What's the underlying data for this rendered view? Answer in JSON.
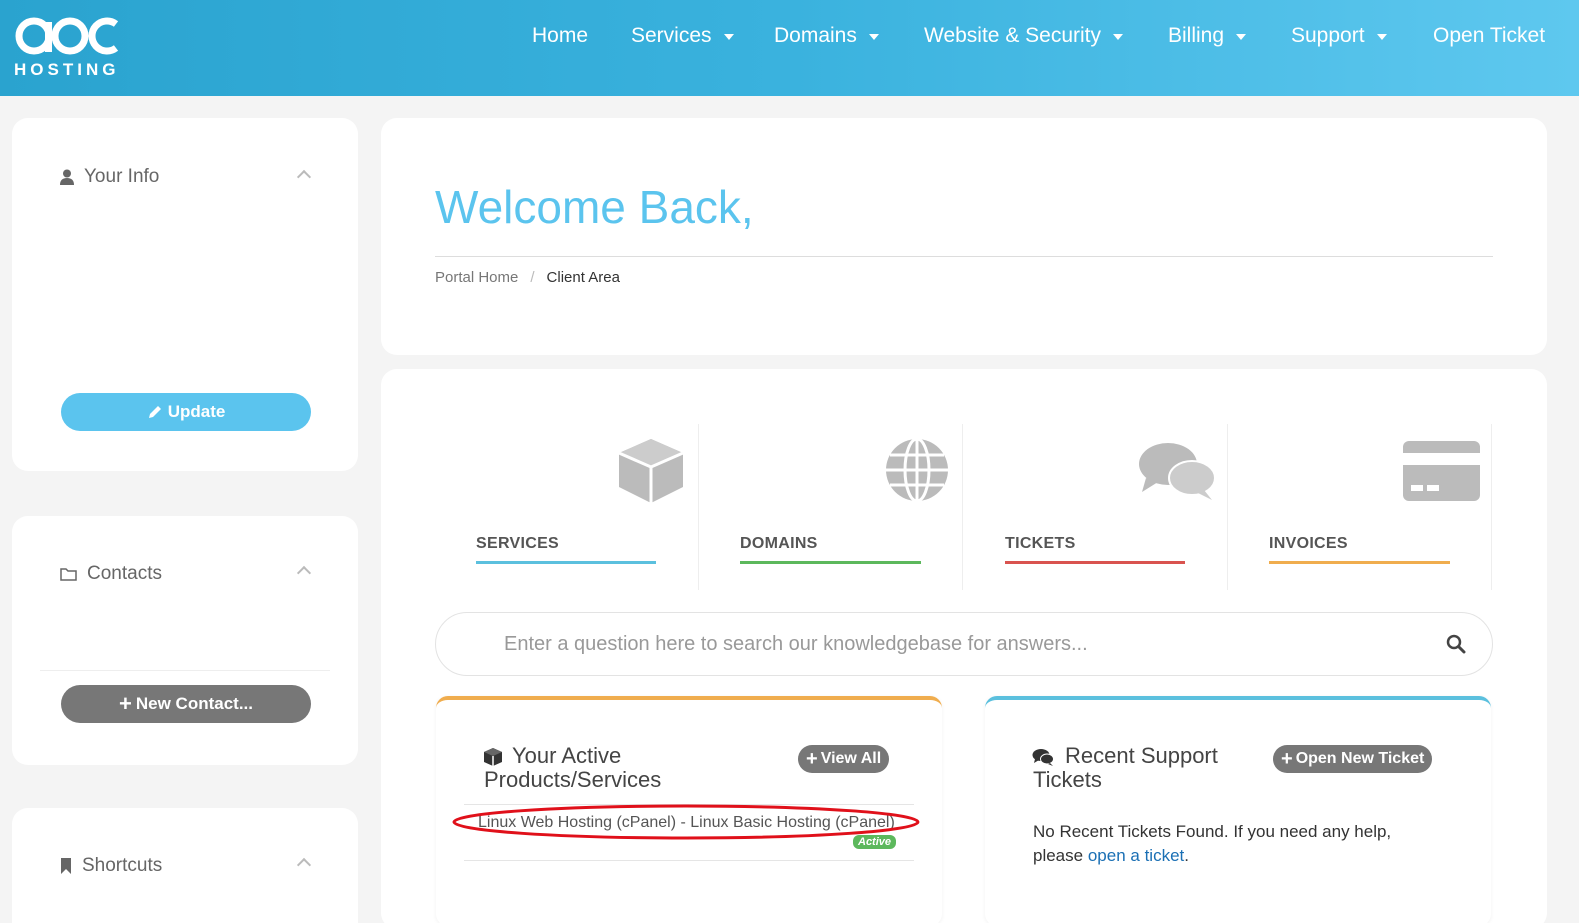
{
  "brand": {
    "logo_letters": "apc",
    "logo_word": "HOSTING"
  },
  "nav": {
    "home": "Home",
    "services": "Services",
    "domains": "Domains",
    "website_security": "Website & Security",
    "billing": "Billing",
    "support": "Support",
    "open_ticket": "Open Ticket"
  },
  "sidebar": {
    "your_info": {
      "title": "Your Info",
      "button": "Update"
    },
    "contacts": {
      "title": "Contacts",
      "button": "New Contact..."
    },
    "shortcuts": {
      "title": "Shortcuts"
    }
  },
  "main": {
    "welcome": "Welcome Back,",
    "breadcrumb": {
      "home": "Portal Home",
      "separator": "/",
      "current": "Client Area"
    }
  },
  "tiles": [
    {
      "label": "SERVICES",
      "color": "#5bc0de"
    },
    {
      "label": "DOMAINS",
      "color": "#5cb85c"
    },
    {
      "label": "TICKETS",
      "color": "#d9534f"
    },
    {
      "label": "INVOICES",
      "color": "#f0ad4e"
    }
  ],
  "search": {
    "placeholder": "Enter a question here to search our knowledgebase for answers..."
  },
  "products_card": {
    "title_line1": "Your Active",
    "title_line2": "Products/Services",
    "view_all": "View All",
    "item": "Linux Web Hosting (cPanel) - Linux Basic Hosting (cPanel)",
    "status": "Active",
    "accent": "#f0ad4e"
  },
  "tickets_card": {
    "title_line1": "Recent Support",
    "title_line2": "Tickets",
    "button": "Open New Ticket",
    "text": "No Recent Tickets Found. If you need any help,",
    "text2": "please",
    "link": "open a ticket",
    "text_end": ".",
    "accent": "#5bc0de"
  }
}
